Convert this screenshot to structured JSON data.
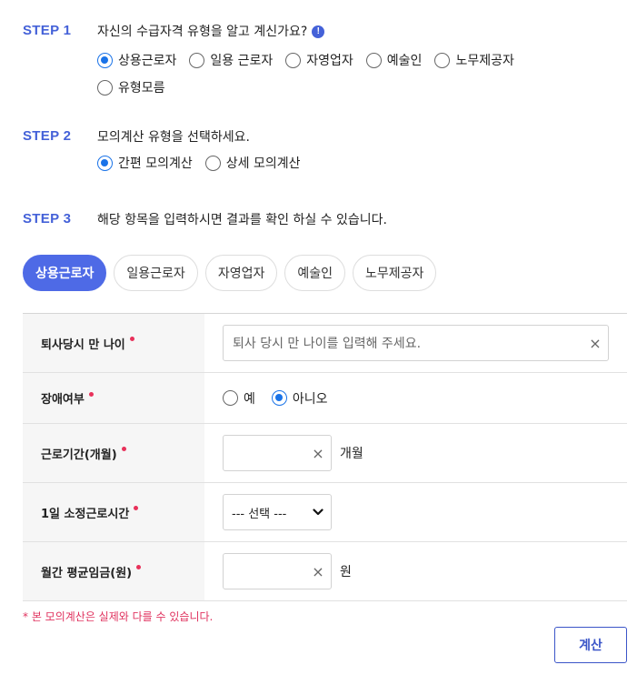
{
  "step1": {
    "label": "STEP 1",
    "question": "자신의 수급자격 유형을 알고 계신가요?",
    "info_icon": "!",
    "options": [
      "상용근로자",
      "일용 근로자",
      "자영업자",
      "예술인",
      "노무제공자",
      "유형모름"
    ],
    "selected": "상용근로자"
  },
  "step2": {
    "label": "STEP 2",
    "question": "모의계산 유형을 선택하세요.",
    "options": [
      "간편 모의계산",
      "상세 모의계산"
    ],
    "selected": "간편 모의계산"
  },
  "step3": {
    "label": "STEP 3",
    "question": "해당 항목을 입력하시면 결과를 확인 하실 수 있습니다."
  },
  "tabs": [
    "상용근로자",
    "일용근로자",
    "자영업자",
    "예술인",
    "노무제공자"
  ],
  "active_tab": "상용근로자",
  "form": {
    "age": {
      "label": "퇴사당시 만 나이",
      "placeholder": "퇴사 당시 만 나이를 입력해 주세요.",
      "clear": "×"
    },
    "disability": {
      "label": "장애여부",
      "options": [
        "예",
        "아니오"
      ],
      "selected": "아니오"
    },
    "period": {
      "label": "근로기간(개월)",
      "clear": "×",
      "unit": "개월"
    },
    "hours": {
      "label": "1일 소정근로시간",
      "select_value": "--- 선택 ---",
      "chevron": "⌄"
    },
    "wage": {
      "label": "월간 평균임금(원)",
      "clear": "×",
      "unit": "원"
    }
  },
  "note": "* 본 모의계산은 실제와 다를 수 있습니다.",
  "calc_button": "계산",
  "colors": {
    "accent": "#4461d8",
    "radio": "#1a73e8",
    "required": "#e8315a"
  }
}
